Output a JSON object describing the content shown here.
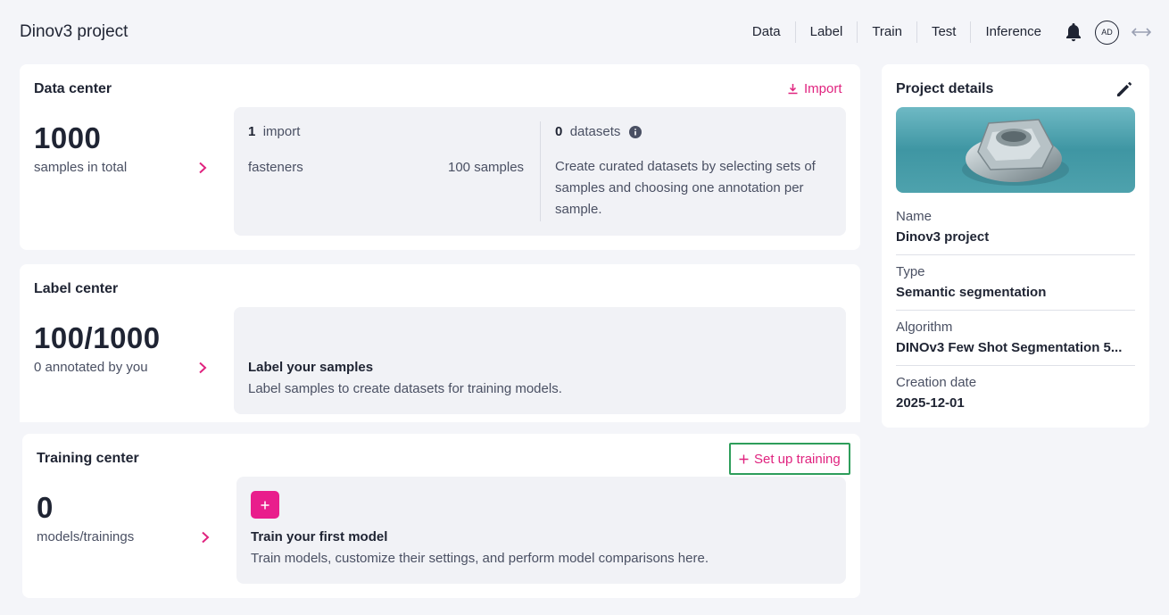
{
  "header": {
    "title": "Dinov3 project",
    "nav": [
      "Data",
      "Label",
      "Train",
      "Test",
      "Inference"
    ],
    "avatar_initials": "AD"
  },
  "data_center": {
    "title": "Data center",
    "import_label": "Import",
    "total": "1000",
    "total_caption": "samples in total",
    "imports_count": "1",
    "imports_label": "import",
    "import_name": "fasteners",
    "import_samples": "100 samples",
    "datasets_count": "0",
    "datasets_label": "datasets",
    "datasets_desc": "Create curated datasets by selecting sets of samples and choosing one annotation per sample."
  },
  "label_center": {
    "title": "Label center",
    "progress": "100/1000",
    "caption": "0 annotated by you",
    "panel_title": "Label your samples",
    "panel_desc": "Label samples to create datasets for training models."
  },
  "training_center": {
    "title": "Training center",
    "setup_label": "Set up training",
    "count": "0",
    "caption": "models/trainings",
    "panel_title": "Train your first model",
    "panel_desc": "Train models, customize their settings, and perform model comparisons here."
  },
  "project_details": {
    "title": "Project details",
    "name_label": "Name",
    "name_value": "Dinov3 project",
    "type_label": "Type",
    "type_value": "Semantic segmentation",
    "algorithm_label": "Algorithm",
    "algorithm_value": "DINOv3 Few Shot Segmentation 5...",
    "date_label": "Creation date",
    "date_value": "2025-12-01"
  },
  "colors": {
    "accent": "#e0237f",
    "highlight_border": "#2e9e5b",
    "background": "#f4f5f9"
  }
}
